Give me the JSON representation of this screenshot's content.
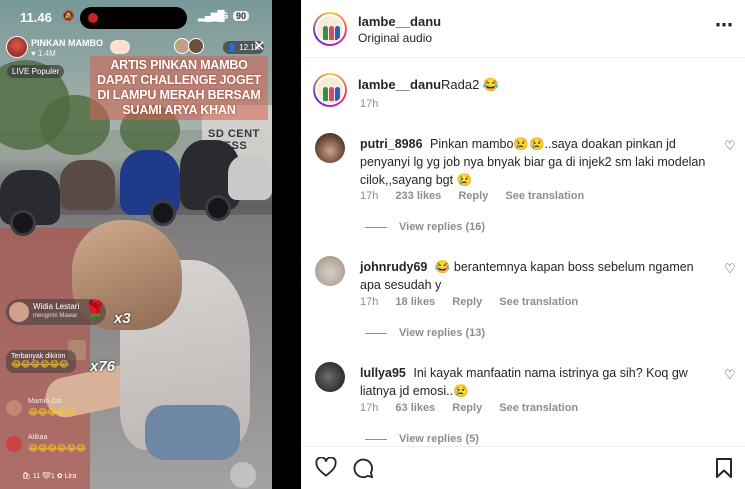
{
  "story": {
    "status_time": "11.46",
    "network": "4G",
    "battery": "90",
    "live_host_name": "PINKAN MAMBO",
    "live_host_followers": "1.4M",
    "viewer_count": "12.1K",
    "live_tag": "LIVE Populer",
    "headline": "ARTIS PINKAN MAMBO DAPAT CHALLENGE JOGET DI LAMPU MERAH BERSAM SUAMI ARYA KHAN",
    "bg_sign_text": "SD CENT TNESS",
    "gift_sender_name": "Widia Lestari",
    "gift_sender_sub": "mengirim Mawar",
    "gift_multiplier_1": "x3",
    "gift_multiplier_2": "x76",
    "top_sender_label": "Terbanyak dikirim",
    "top_sender_emojis": "😂😂😂😂😂😂",
    "chat": [
      {
        "name": "Mamih Zizi",
        "emojis": "😂😂😂😂😂"
      },
      {
        "name": "Atikaa",
        "emojis": "😂😂😂😂😂😂"
      }
    ],
    "bottom_text": "🛍 11   ❤1   ✿ Lira"
  },
  "post": {
    "username": "lambe__danu",
    "audio": "Original audio",
    "caption_text": "Rada2 😂",
    "caption_time": "17h"
  },
  "comments": [
    {
      "user": "putri_8986",
      "text": "Pinkan mambo😢😢..saya doakan pinkan jd penyanyi lg yg job nya bnyak biar ga di injek2 sm laki modelan cilok,,sayang bgt 😢",
      "time": "17h",
      "likes": "233 likes",
      "reply": "Reply",
      "translate": "See translation",
      "view_replies": "View replies (16)"
    },
    {
      "user": "johnrudy69",
      "text": "😂 berantemnya kapan boss sebelum ngamen apa sesudah y",
      "time": "17h",
      "likes": "18 likes",
      "reply": "Reply",
      "translate": "See translation",
      "view_replies": "View replies (13)"
    },
    {
      "user": "lullya95",
      "text": "Ini kayak manfaatin nama istrinya ga sih? Koq gw liatnya jd emosi..😢",
      "time": "17h",
      "likes": "63 likes",
      "reply": "Reply",
      "translate": "See translation",
      "view_replies": "View replies (5)"
    }
  ],
  "icons": {
    "more": "more-options-icon",
    "like": "heart-icon",
    "comment": "comment-icon",
    "save": "bookmark-icon"
  },
  "colors": {
    "headline_bg": "#d6604e",
    "meta_gray": "#8e8e8e",
    "text": "#262626"
  }
}
